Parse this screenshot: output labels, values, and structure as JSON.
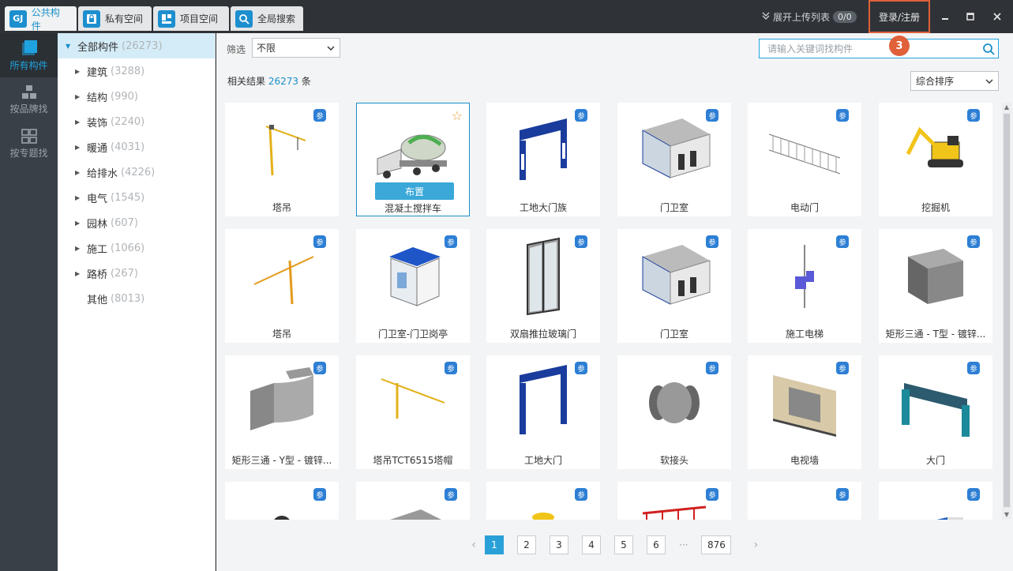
{
  "tabs": [
    {
      "label": "公共构件",
      "icon": "GJ",
      "active": true
    },
    {
      "label": "私有空间",
      "icon": "lock-folder-icon"
    },
    {
      "label": "项目空间",
      "icon": "project-icon"
    },
    {
      "label": "全局搜索",
      "icon": "search-icon"
    }
  ],
  "header": {
    "upload_toggle": "展开上传列表",
    "upload_count": "0/0",
    "login": "登录/注册",
    "step_badge": "3"
  },
  "rail": [
    {
      "label": "所有构件",
      "active": true
    },
    {
      "label": "按品牌找"
    },
    {
      "label": "按专题找"
    }
  ],
  "tree": {
    "root": {
      "label": "全部构件",
      "count": "(26273)"
    },
    "children": [
      {
        "label": "建筑",
        "count": "(3288)"
      },
      {
        "label": "结构",
        "count": "(990)"
      },
      {
        "label": "装饰",
        "count": "(2240)"
      },
      {
        "label": "暖通",
        "count": "(4031)"
      },
      {
        "label": "给排水",
        "count": "(4226)"
      },
      {
        "label": "电气",
        "count": "(1545)"
      },
      {
        "label": "园林",
        "count": "(607)"
      },
      {
        "label": "施工",
        "count": "(1066)"
      },
      {
        "label": "路桥",
        "count": "(267)"
      }
    ],
    "leaf": {
      "label": "其他",
      "count": "(8013)"
    }
  },
  "filter": {
    "label": "筛选",
    "value": "不限"
  },
  "search": {
    "placeholder": "请输入关键词找构件"
  },
  "results": {
    "prefix": "相关结果",
    "count": "26273",
    "suffix": "条"
  },
  "sort": {
    "value": "综合排序"
  },
  "badge": {
    "param": "参"
  },
  "place_button": "布置",
  "cards": [
    "塔吊",
    "混凝土搅拌车",
    "工地大门族",
    "门卫室",
    "电动门",
    "挖掘机",
    "塔吊",
    "门卫室-门卫岗亭",
    "双扇推拉玻璃门",
    "门卫室",
    "施工电梯",
    "矩形三通 - T型 - 镀锌...",
    "矩形三通 - Y型 - 镀锌...",
    "塔吊TCT6515塔帽",
    "工地大门",
    "软接头",
    "电视墙",
    "大门",
    "",
    "",
    "",
    "",
    "",
    ""
  ],
  "pagination": {
    "pages": [
      "1",
      "2",
      "3",
      "4",
      "5",
      "6"
    ],
    "ellipsis": "···",
    "last": "876",
    "current": "1"
  }
}
